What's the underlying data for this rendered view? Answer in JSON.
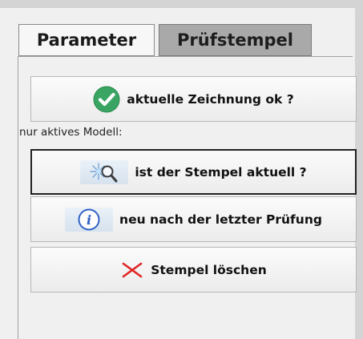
{
  "tabs": [
    {
      "label": "Parameter",
      "selected": false
    },
    {
      "label": "Prüfstempel",
      "selected": true
    }
  ],
  "buttons": {
    "check_drawing": {
      "label": "aktuelle Zeichnung ok ?",
      "icon": "check-circle-icon"
    },
    "stamp_current": {
      "label": "ist der Stempel aktuell ?",
      "icon": "magnifier-sparkle-icon"
    },
    "new_since_check": {
      "label": "neu nach der letzter Prüfung",
      "icon": "info-icon"
    },
    "delete_stamp": {
      "label": "Stempel löschen",
      "icon": "red-x-icon"
    }
  },
  "section": {
    "active_model_label": "nur aktives Modell:"
  },
  "colors": {
    "tab_selected_bg": "#a9a9a9",
    "check_green": "#3aa563",
    "delete_red": "#e02424",
    "info_blue": "#2f62c4"
  }
}
